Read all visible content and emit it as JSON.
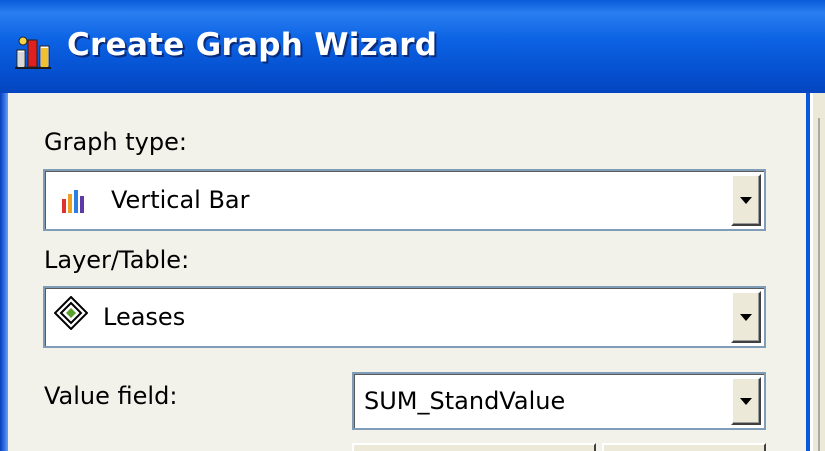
{
  "window": {
    "title": "Create Graph Wizard",
    "title_icon": "graph-wizard-icon"
  },
  "form": {
    "graph_type": {
      "label": "Graph type:",
      "value": "Vertical Bar",
      "icon": "vertical-bar-chart-icon"
    },
    "layer_table": {
      "label": "Layer/Table:",
      "value": "Leases",
      "icon": "layer-diamond-icon"
    },
    "value_field": {
      "label": "Value field:",
      "value": "SUM_StandValue"
    }
  },
  "colors": {
    "titlebar": "#0a5bd8",
    "title_text": "#ffffff",
    "dialog_bg": "#f2f1ea",
    "combo_border": "#7f9db9"
  }
}
